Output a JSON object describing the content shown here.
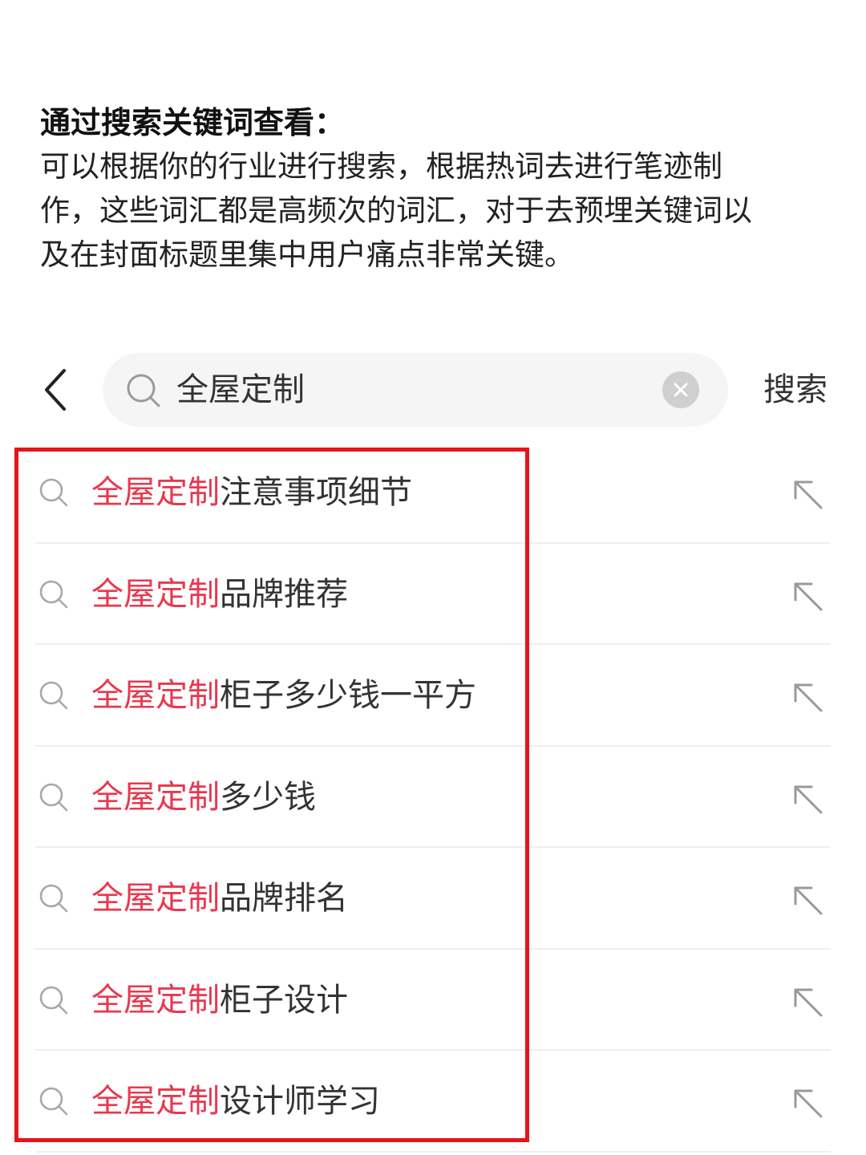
{
  "intro": {
    "heading": "通过搜索关键词查看：",
    "body_lines": [
      "可以根据你的行业进行搜索，根据热词去进行笔迹制",
      "作，这些词汇都是高频次的词汇，对于去预埋关键词以",
      "及在封面标题里集中用户痛点非常关键。"
    ]
  },
  "search": {
    "query": "全屋定制",
    "action_label": "搜索"
  },
  "suggestions": [
    {
      "highlight": "全屋定制",
      "rest": "注意事项细节"
    },
    {
      "highlight": "全屋定制",
      "rest": "品牌推荐"
    },
    {
      "highlight": "全屋定制",
      "rest": "柜子多少钱一平方"
    },
    {
      "highlight": "全屋定制",
      "rest": "多少钱"
    },
    {
      "highlight": "全屋定制",
      "rest": "品牌排名"
    },
    {
      "highlight": "全屋定制",
      "rest": "柜子设计"
    },
    {
      "highlight": "全屋定制",
      "rest": "设计师学习"
    }
  ],
  "colors": {
    "highlight_text": "#e8384f",
    "annotation_frame": "#e5141b"
  }
}
